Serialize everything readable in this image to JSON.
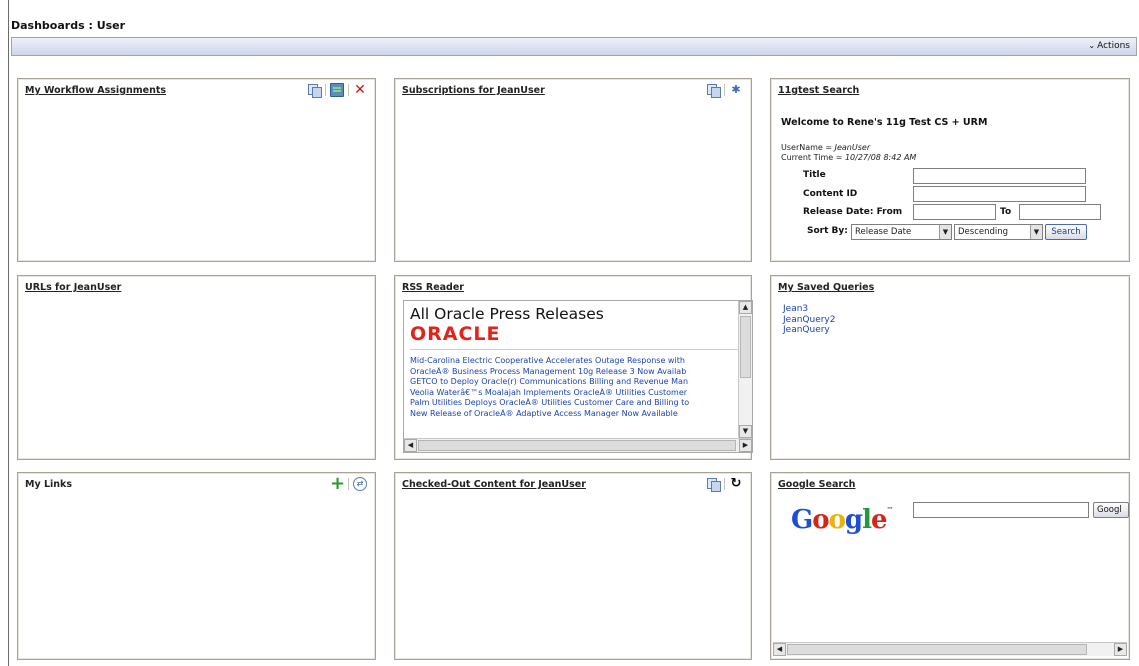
{
  "page": {
    "title": "Dashboards : User"
  },
  "actions": {
    "label": "Actions",
    "chevron": "⌄"
  },
  "panels": {
    "workflow": {
      "title": "My Workflow Assignments"
    },
    "subscriptions": {
      "title": "Subscriptions for JeanUser"
    },
    "search11g": {
      "title": "11gtest Search",
      "welcome": "Welcome to Rene's 11g Test CS + URM",
      "username_label": "UserName = ",
      "username": "JeanUser",
      "time_label": "Current Time = ",
      "time": "10/27/08 8:42 AM",
      "title_label": "Title",
      "contentid_label": "Content ID",
      "release_label": "Release Date: From",
      "to_label": "To",
      "sortby_label": "Sort By:",
      "sort_field": "Release Date",
      "sort_order": "Descending",
      "search_button": "Search"
    },
    "urls": {
      "title": "URLs for JeanUser"
    },
    "rss": {
      "title": "RSS Reader",
      "heading": "All Oracle Press Releases",
      "logo": "ORACLE",
      "items": [
        "Mid-Carolina Electric Cooperative Accelerates Outage Response with",
        "OracleÂ® Business Process Management 10g Release 3 Now Availab",
        "GETCO to Deploy Oracle(r) Communications Billing and Revenue Man",
        "Veolia Waterâ€™s Moalajah Implements OracleÂ® Utilities Customer",
        "Palm Utilities Deploys OracleÂ® Utilities Customer Care and Billing to",
        "New Release of OracleÂ® Adaptive Access Manager Now Available"
      ]
    },
    "savedQueries": {
      "title": "My Saved Queries",
      "items": [
        "Jean3",
        "JeanQuery2",
        "JeanQuery"
      ]
    },
    "links": {
      "title": "My Links"
    },
    "checkedOut": {
      "title": "Checked-Out Content for JeanUser"
    },
    "google": {
      "title": "Google Search",
      "logo": [
        "G",
        "o",
        "o",
        "g",
        "l",
        "e"
      ],
      "button": "Googl"
    }
  },
  "colors": {
    "link": "#1a44b8",
    "oracle_red": "#e2231a",
    "panel_border": "#a9a296"
  }
}
